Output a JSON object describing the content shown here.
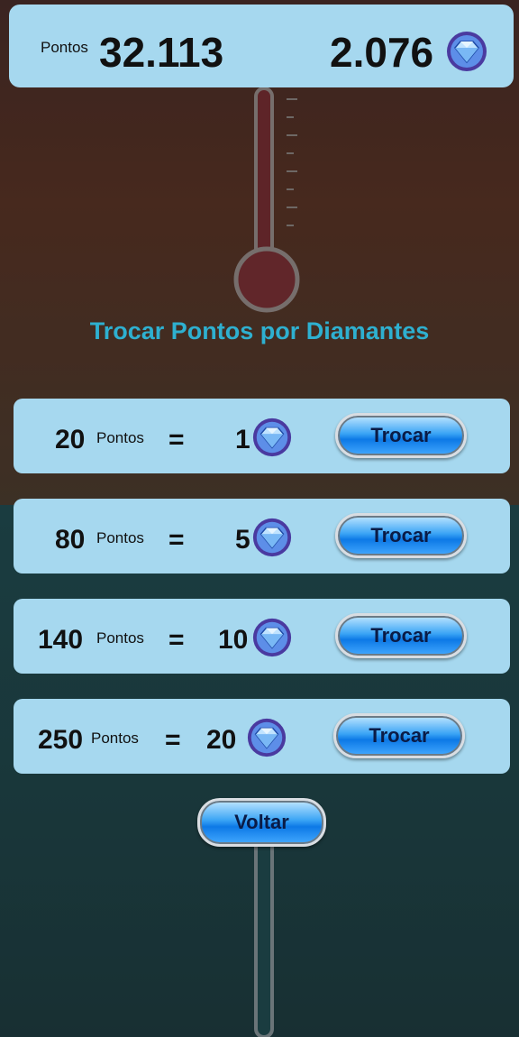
{
  "header": {
    "points_label": "Pontos",
    "points_value": "32.113",
    "diamonds_value": "2.076"
  },
  "title": "Trocar Pontos por Diamantes",
  "rows": [
    {
      "points": "20",
      "points_label": "Pontos",
      "equals": "=",
      "diamonds": "1",
      "button_label": "Trocar"
    },
    {
      "points": "80",
      "points_label": "Pontos",
      "equals": "=",
      "diamonds": "5",
      "button_label": "Trocar"
    },
    {
      "points": "140",
      "points_label": "Pontos",
      "equals": "=",
      "diamonds": "10",
      "button_label": "Trocar"
    },
    {
      "points": "250",
      "points_label": "Pontos",
      "equals": "=",
      "diamonds": "20",
      "button_label": "Trocar"
    }
  ],
  "back_button_label": "Voltar",
  "colors": {
    "panel": "#a6d8ef",
    "title": "#2eb0d0",
    "button": "#1a86ee",
    "gem": "#3f8ff0"
  },
  "icons": {
    "diamond": "diamond-icon"
  }
}
